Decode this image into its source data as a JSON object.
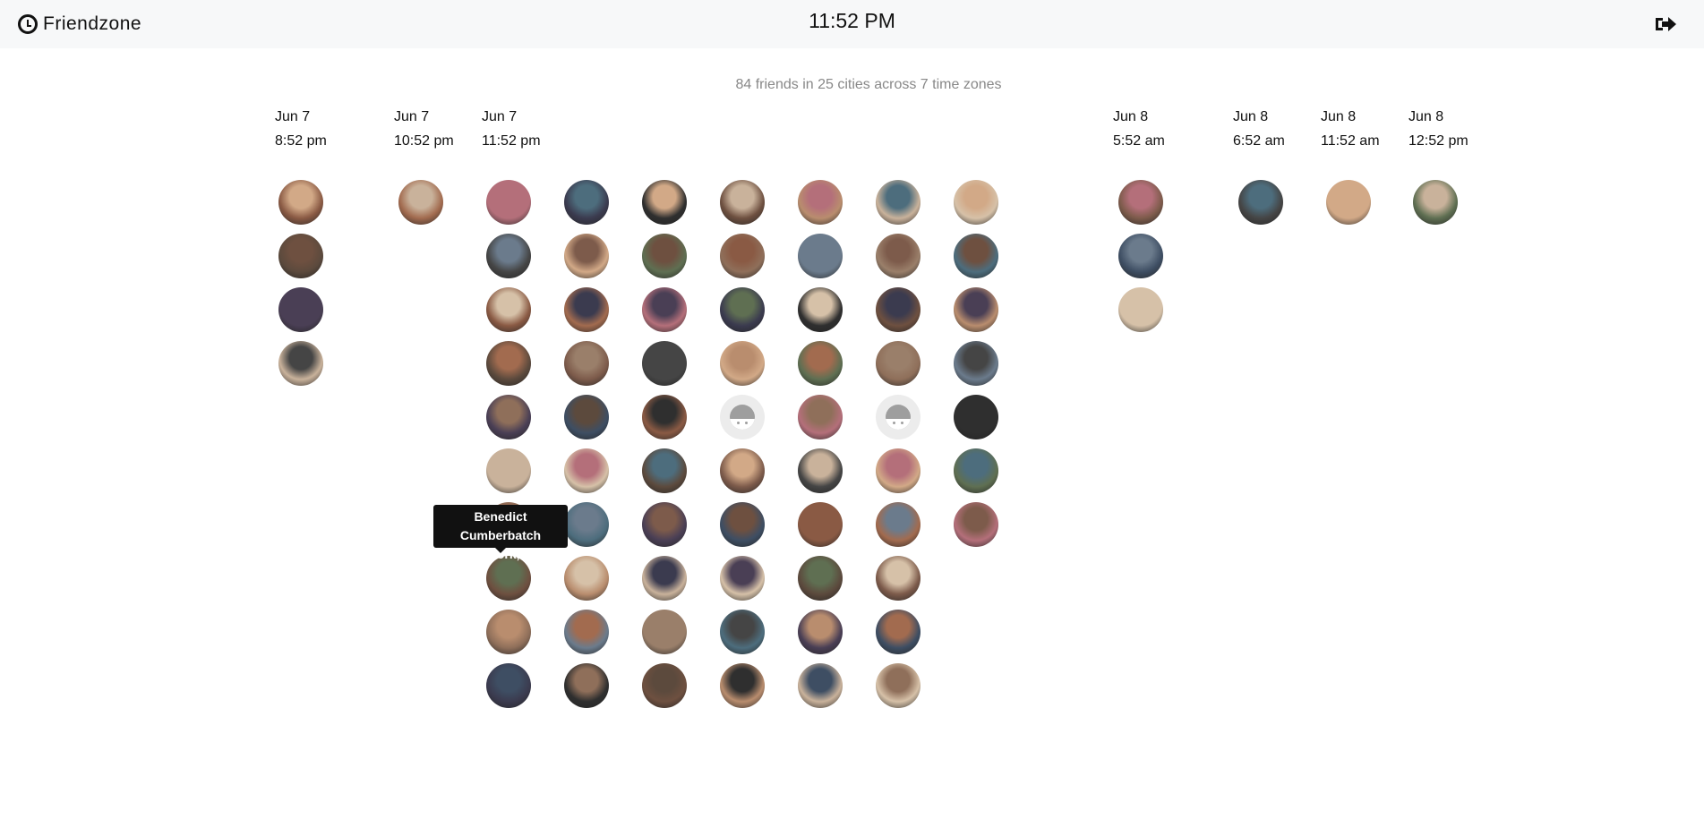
{
  "app": {
    "name": "Friendzone",
    "current_time": "11:52 PM"
  },
  "icons": {
    "brand": "clock-icon",
    "logout": "logout-icon"
  },
  "summary": "84 friends in 25 cities across 7 time zones",
  "timezones": [
    {
      "date": "Jun 7",
      "time": "8:52 pm"
    },
    {
      "date": "Jun 7",
      "time": "10:52 pm"
    },
    {
      "date": "Jun 7",
      "time": "11:52 pm"
    },
    {
      "date": "Jun 8",
      "time": "5:52 am"
    },
    {
      "date": "Jun 8",
      "time": "6:52 am"
    },
    {
      "date": "Jun 8",
      "time": "11:52 am"
    },
    {
      "date": "Jun 8",
      "time": "12:52 pm"
    }
  ],
  "friend_counts": [
    4,
    1,
    67,
    3,
    1,
    1,
    1
  ],
  "tooltip": {
    "name": "Benedict Cumberbatch",
    "location": "New York, NY"
  }
}
